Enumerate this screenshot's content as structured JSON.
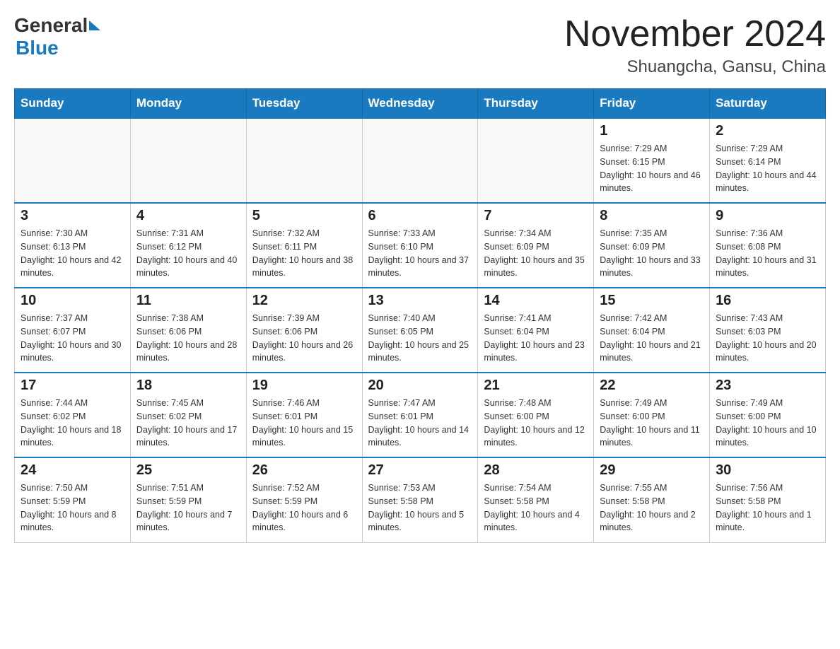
{
  "header": {
    "logo_general": "General",
    "logo_blue": "Blue",
    "month_year": "November 2024",
    "location": "Shuangcha, Gansu, China"
  },
  "weekdays": [
    "Sunday",
    "Monday",
    "Tuesday",
    "Wednesday",
    "Thursday",
    "Friday",
    "Saturday"
  ],
  "weeks": [
    [
      {
        "day": "",
        "info": ""
      },
      {
        "day": "",
        "info": ""
      },
      {
        "day": "",
        "info": ""
      },
      {
        "day": "",
        "info": ""
      },
      {
        "day": "",
        "info": ""
      },
      {
        "day": "1",
        "info": "Sunrise: 7:29 AM\nSunset: 6:15 PM\nDaylight: 10 hours and 46 minutes."
      },
      {
        "day": "2",
        "info": "Sunrise: 7:29 AM\nSunset: 6:14 PM\nDaylight: 10 hours and 44 minutes."
      }
    ],
    [
      {
        "day": "3",
        "info": "Sunrise: 7:30 AM\nSunset: 6:13 PM\nDaylight: 10 hours and 42 minutes."
      },
      {
        "day": "4",
        "info": "Sunrise: 7:31 AM\nSunset: 6:12 PM\nDaylight: 10 hours and 40 minutes."
      },
      {
        "day": "5",
        "info": "Sunrise: 7:32 AM\nSunset: 6:11 PM\nDaylight: 10 hours and 38 minutes."
      },
      {
        "day": "6",
        "info": "Sunrise: 7:33 AM\nSunset: 6:10 PM\nDaylight: 10 hours and 37 minutes."
      },
      {
        "day": "7",
        "info": "Sunrise: 7:34 AM\nSunset: 6:09 PM\nDaylight: 10 hours and 35 minutes."
      },
      {
        "day": "8",
        "info": "Sunrise: 7:35 AM\nSunset: 6:09 PM\nDaylight: 10 hours and 33 minutes."
      },
      {
        "day": "9",
        "info": "Sunrise: 7:36 AM\nSunset: 6:08 PM\nDaylight: 10 hours and 31 minutes."
      }
    ],
    [
      {
        "day": "10",
        "info": "Sunrise: 7:37 AM\nSunset: 6:07 PM\nDaylight: 10 hours and 30 minutes."
      },
      {
        "day": "11",
        "info": "Sunrise: 7:38 AM\nSunset: 6:06 PM\nDaylight: 10 hours and 28 minutes."
      },
      {
        "day": "12",
        "info": "Sunrise: 7:39 AM\nSunset: 6:06 PM\nDaylight: 10 hours and 26 minutes."
      },
      {
        "day": "13",
        "info": "Sunrise: 7:40 AM\nSunset: 6:05 PM\nDaylight: 10 hours and 25 minutes."
      },
      {
        "day": "14",
        "info": "Sunrise: 7:41 AM\nSunset: 6:04 PM\nDaylight: 10 hours and 23 minutes."
      },
      {
        "day": "15",
        "info": "Sunrise: 7:42 AM\nSunset: 6:04 PM\nDaylight: 10 hours and 21 minutes."
      },
      {
        "day": "16",
        "info": "Sunrise: 7:43 AM\nSunset: 6:03 PM\nDaylight: 10 hours and 20 minutes."
      }
    ],
    [
      {
        "day": "17",
        "info": "Sunrise: 7:44 AM\nSunset: 6:02 PM\nDaylight: 10 hours and 18 minutes."
      },
      {
        "day": "18",
        "info": "Sunrise: 7:45 AM\nSunset: 6:02 PM\nDaylight: 10 hours and 17 minutes."
      },
      {
        "day": "19",
        "info": "Sunrise: 7:46 AM\nSunset: 6:01 PM\nDaylight: 10 hours and 15 minutes."
      },
      {
        "day": "20",
        "info": "Sunrise: 7:47 AM\nSunset: 6:01 PM\nDaylight: 10 hours and 14 minutes."
      },
      {
        "day": "21",
        "info": "Sunrise: 7:48 AM\nSunset: 6:00 PM\nDaylight: 10 hours and 12 minutes."
      },
      {
        "day": "22",
        "info": "Sunrise: 7:49 AM\nSunset: 6:00 PM\nDaylight: 10 hours and 11 minutes."
      },
      {
        "day": "23",
        "info": "Sunrise: 7:49 AM\nSunset: 6:00 PM\nDaylight: 10 hours and 10 minutes."
      }
    ],
    [
      {
        "day": "24",
        "info": "Sunrise: 7:50 AM\nSunset: 5:59 PM\nDaylight: 10 hours and 8 minutes."
      },
      {
        "day": "25",
        "info": "Sunrise: 7:51 AM\nSunset: 5:59 PM\nDaylight: 10 hours and 7 minutes."
      },
      {
        "day": "26",
        "info": "Sunrise: 7:52 AM\nSunset: 5:59 PM\nDaylight: 10 hours and 6 minutes."
      },
      {
        "day": "27",
        "info": "Sunrise: 7:53 AM\nSunset: 5:58 PM\nDaylight: 10 hours and 5 minutes."
      },
      {
        "day": "28",
        "info": "Sunrise: 7:54 AM\nSunset: 5:58 PM\nDaylight: 10 hours and 4 minutes."
      },
      {
        "day": "29",
        "info": "Sunrise: 7:55 AM\nSunset: 5:58 PM\nDaylight: 10 hours and 2 minutes."
      },
      {
        "day": "30",
        "info": "Sunrise: 7:56 AM\nSunset: 5:58 PM\nDaylight: 10 hours and 1 minute."
      }
    ]
  ]
}
